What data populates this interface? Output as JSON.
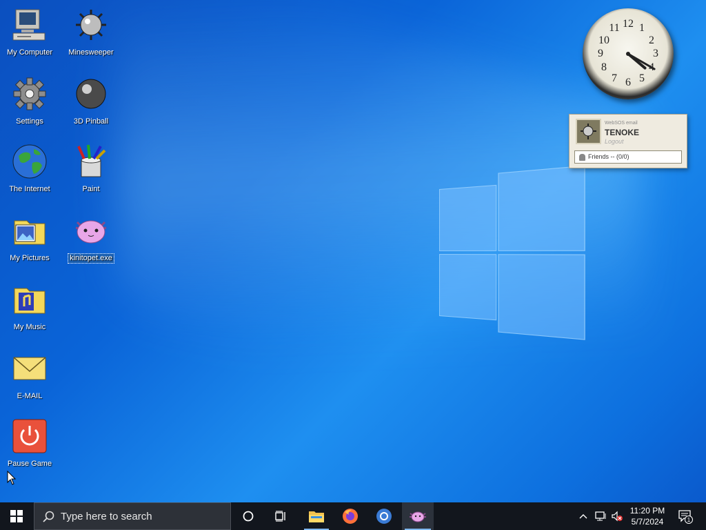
{
  "desktop": {
    "icons": [
      {
        "label": "My Computer"
      },
      {
        "label": "Minesweeper"
      },
      {
        "label": "Settings"
      },
      {
        "label": "3D Pinball"
      },
      {
        "label": "The Internet"
      },
      {
        "label": "Paint"
      },
      {
        "label": "My Pictures"
      },
      {
        "label": "kinitopet.exe"
      },
      {
        "label": "My Music"
      },
      {
        "label": "E-MAIL"
      },
      {
        "label": "Pause Game"
      }
    ]
  },
  "clock": {
    "numbers": [
      "12",
      "1",
      "2",
      "3",
      "4",
      "5",
      "6",
      "7",
      "8",
      "9",
      "10",
      "11"
    ],
    "time": {
      "hour": 4,
      "minute": 20
    }
  },
  "messenger": {
    "service": "WebSOS email",
    "username": "TENOKE",
    "logout": "Logout",
    "friends": "Friends -- (0/0)"
  },
  "taskbar": {
    "search_placeholder": "Type here to search",
    "time": "11:20 PM",
    "date": "5/7/2024",
    "notification_count": "1"
  },
  "colors": {
    "desktop_blue": "#0a64d8",
    "taskbar": "#12161d",
    "search_box": "#2d3138",
    "accent": "#7fb8f0"
  }
}
